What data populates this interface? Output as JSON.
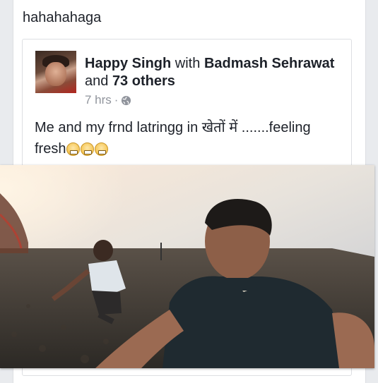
{
  "post": {
    "text": "hahahahaga"
  },
  "shared_post": {
    "author": "Happy Singh",
    "with_word": "with",
    "tagged": "Badmash Sehrawat",
    "and_word": "and",
    "others": "73 others",
    "time": "7 hrs",
    "separator": "·",
    "audience_icon": "globe-icon",
    "body": "Me and my frnd latringg in खेतों में .......feeling fresh",
    "emojis": [
      "grimace-emoji",
      "grimace-emoji",
      "grimace-emoji"
    ]
  },
  "colors": {
    "text": "#1d2129",
    "meta": "#90949c",
    "border": "#dddfe2",
    "background": "#e9ebee"
  }
}
